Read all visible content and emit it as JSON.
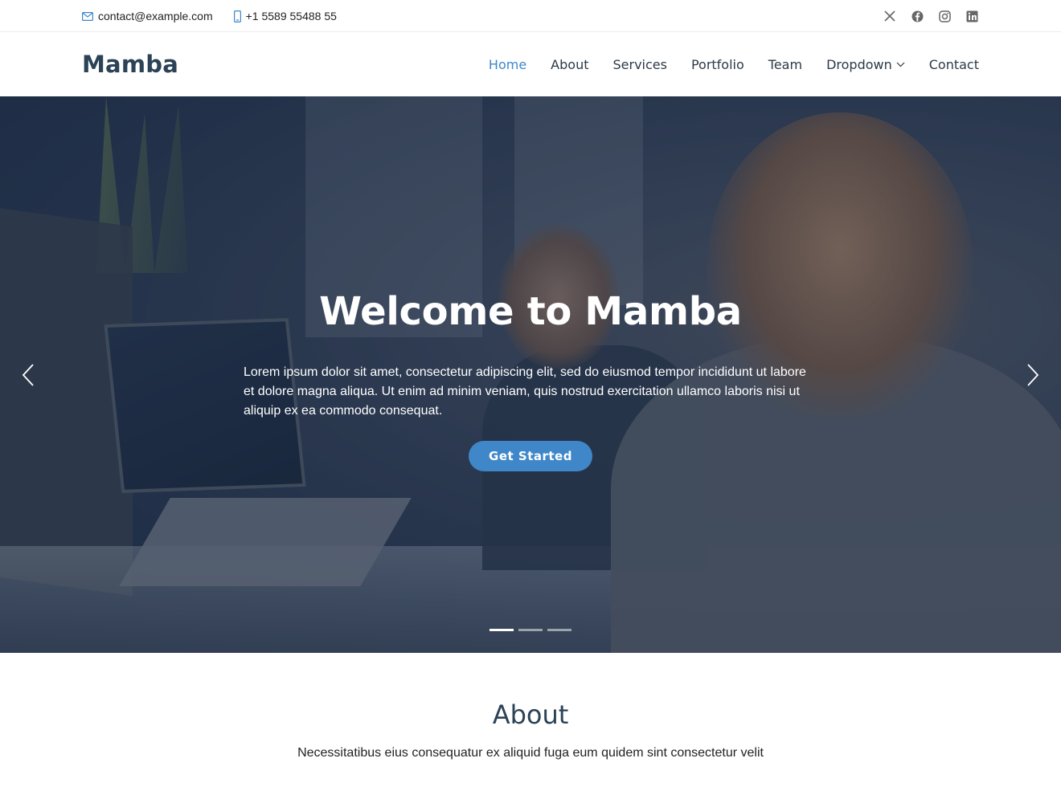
{
  "topbar": {
    "email": "contact@example.com",
    "phone": "+1 5589 55488 55",
    "social": [
      "x-icon",
      "facebook-icon",
      "instagram-icon",
      "linkedin-icon"
    ]
  },
  "header": {
    "logo": "Mamba",
    "nav": [
      {
        "label": "Home",
        "active": true
      },
      {
        "label": "About"
      },
      {
        "label": "Services"
      },
      {
        "label": "Portfolio"
      },
      {
        "label": "Team"
      },
      {
        "label": "Dropdown",
        "has_dropdown": true
      },
      {
        "label": "Contact"
      }
    ]
  },
  "hero": {
    "title": "Welcome to Mamba",
    "text": "Lorem ipsum dolor sit amet, consectetur adipiscing elit, sed do eiusmod tempor incididunt ut labore et dolore magna aliqua. Ut enim ad minim veniam, quis nostrud exercitation ullamco laboris nisi ut aliquip ex ea commodo consequat.",
    "button": "Get Started",
    "slides": 3,
    "active_slide": 1
  },
  "about": {
    "title": "About",
    "subtitle": "Necessitatibus eius consequatur ex aliquid fuga eum quidem sint consectetur velit"
  },
  "colors": {
    "accent": "#3f87c9",
    "heading": "#2b4257"
  }
}
